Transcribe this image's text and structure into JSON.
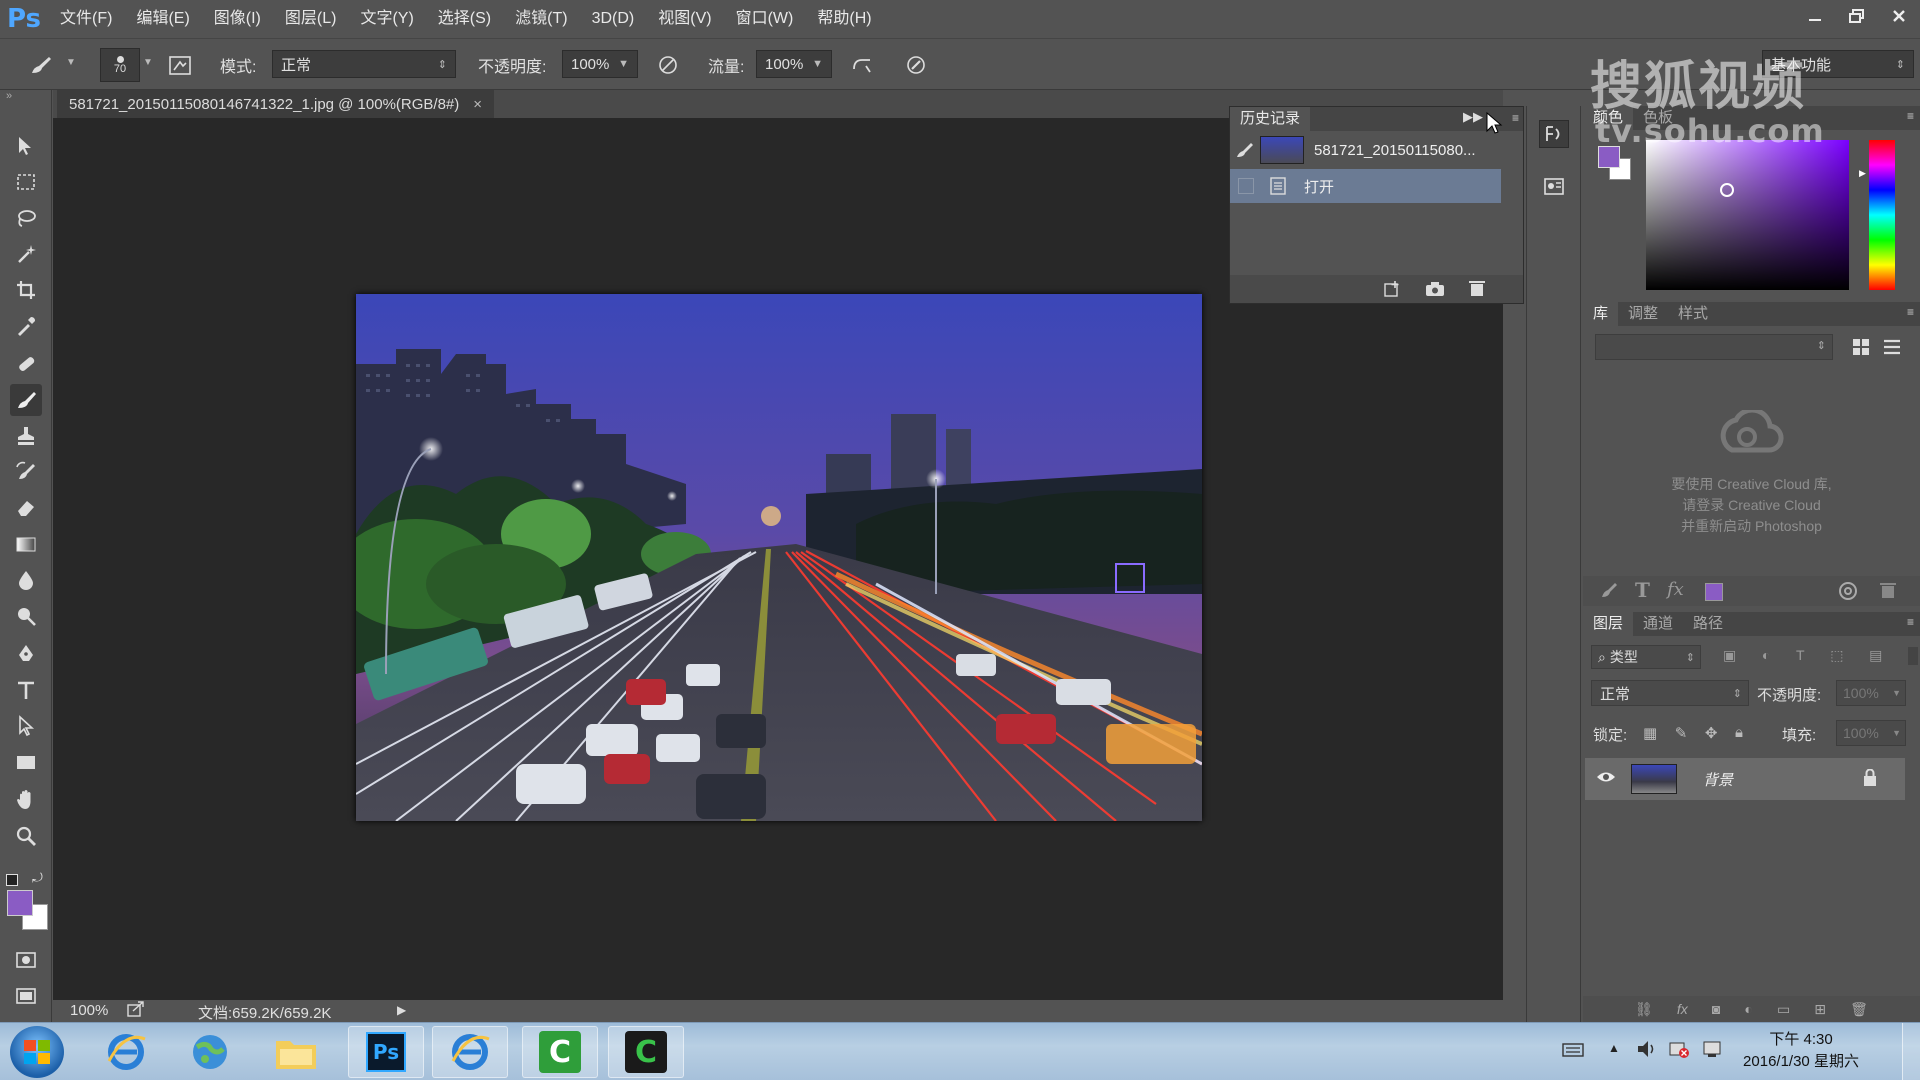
{
  "app": {
    "logo": "Ps"
  },
  "menu": [
    "文件(F)",
    "编辑(E)",
    "图像(I)",
    "图层(L)",
    "文字(Y)",
    "选择(S)",
    "滤镜(T)",
    "3D(D)",
    "视图(V)",
    "窗口(W)",
    "帮助(H)"
  ],
  "options": {
    "brush_size": "70",
    "mode_label": "模式:",
    "mode_value": "正常",
    "opacity_label": "不透明度:",
    "opacity_value": "100%",
    "flow_label": "流量:",
    "flow_value": "100%",
    "workspace": "基本功能"
  },
  "document": {
    "tab_title": "581721_20150115080146741322_1.jpg @ 100%(RGB/8#)",
    "close": "×"
  },
  "status": {
    "zoom": "100%",
    "doc_size": "文档:659.2K/659.2K"
  },
  "history": {
    "title": "历史记录",
    "snapshot": "581721_20150115080...",
    "step": "打开"
  },
  "color_panel": {
    "tabs": [
      "颜色",
      "色板"
    ],
    "accent": "#8a5cc4"
  },
  "library_panel": {
    "tabs": [
      "库",
      "调整",
      "样式"
    ],
    "message_line1": "要使用 Creative Cloud 库,",
    "message_line2": "请登录 Creative Cloud",
    "message_line3": "并重新启动 Photoshop"
  },
  "layers_panel": {
    "tabs": [
      "图层",
      "通道",
      "路径"
    ],
    "filter_label": "类型",
    "blend_mode": "正常",
    "opacity_label": "不透明度:",
    "opacity_value": "100%",
    "lock_label": "锁定:",
    "fill_label": "填充:",
    "fill_value": "100%",
    "layer_name": "背景"
  },
  "taskbar": {
    "time": "下午 4:30",
    "date": "2016/1/30 星期六"
  },
  "watermark": {
    "text": "搜狐视频",
    "url": "tv.sohu.com"
  }
}
